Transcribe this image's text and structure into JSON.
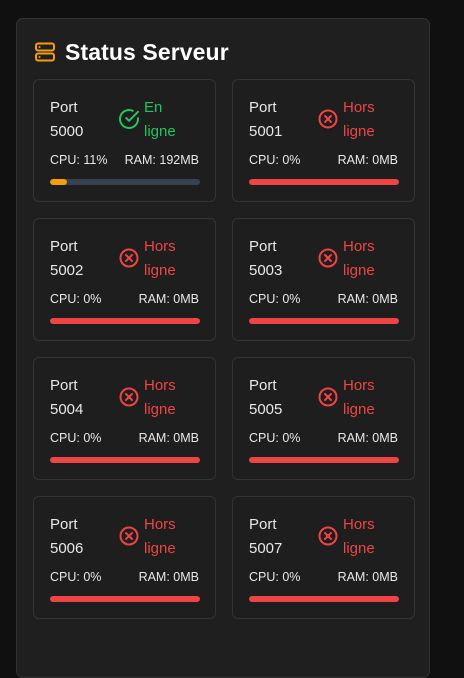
{
  "panel": {
    "title": "Status Serveur",
    "icon": "server-icon"
  },
  "colors": {
    "online": "#22c55e",
    "offline": "#ef4444",
    "accent": "#f59e0b",
    "track": "#374151"
  },
  "servers": [
    {
      "port": "Port 5000",
      "status_line1": "En",
      "status_line2": "ligne",
      "online": true,
      "cpu": "CPU: 11%",
      "ram": "RAM: 192MB",
      "cpu_fraction": 0.11
    },
    {
      "port": "Port 5001",
      "status_line1": "Hors",
      "status_line2": "ligne",
      "online": false,
      "cpu": "CPU: 0%",
      "ram": "RAM: 0MB",
      "cpu_fraction": 0
    },
    {
      "port": "Port 5002",
      "status_line1": "Hors",
      "status_line2": "ligne",
      "online": false,
      "cpu": "CPU: 0%",
      "ram": "RAM: 0MB",
      "cpu_fraction": 0
    },
    {
      "port": "Port 5003",
      "status_line1": "Hors",
      "status_line2": "ligne",
      "online": false,
      "cpu": "CPU: 0%",
      "ram": "RAM: 0MB",
      "cpu_fraction": 0
    },
    {
      "port": "Port 5004",
      "status_line1": "Hors",
      "status_line2": "ligne",
      "online": false,
      "cpu": "CPU: 0%",
      "ram": "RAM: 0MB",
      "cpu_fraction": 0
    },
    {
      "port": "Port 5005",
      "status_line1": "Hors",
      "status_line2": "ligne",
      "online": false,
      "cpu": "CPU: 0%",
      "ram": "RAM: 0MB",
      "cpu_fraction": 0
    },
    {
      "port": "Port 5006",
      "status_line1": "Hors",
      "status_line2": "ligne",
      "online": false,
      "cpu": "CPU: 0%",
      "ram": "RAM: 0MB",
      "cpu_fraction": 0
    },
    {
      "port": "Port 5007",
      "status_line1": "Hors",
      "status_line2": "ligne",
      "online": false,
      "cpu": "CPU: 0%",
      "ram": "RAM: 0MB",
      "cpu_fraction": 0
    }
  ]
}
